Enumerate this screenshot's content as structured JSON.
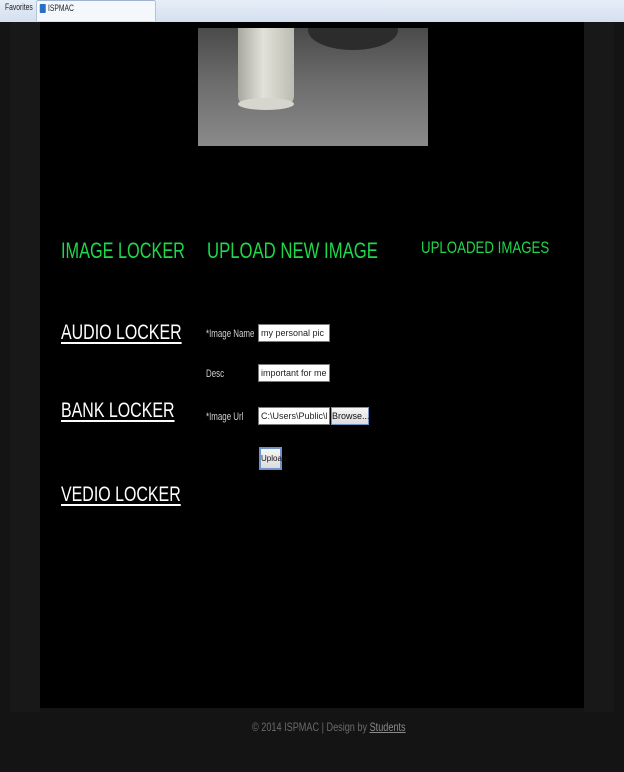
{
  "browser": {
    "tabs": [
      {
        "label": "Favorites"
      },
      {
        "label": "ISPMAC"
      }
    ]
  },
  "sidebar": {
    "title": "IMAGE LOCKER",
    "links": [
      {
        "label": "AUDIO LOCKER"
      },
      {
        "label": "BANK LOCKER"
      },
      {
        "label": "VEDIO LOCKER"
      }
    ]
  },
  "upload": {
    "title": "UPLOAD NEW IMAGE",
    "image_name_label": "Image Name",
    "image_name_value": "my personal pic",
    "desc_label": "Desc",
    "desc_value": "important for me",
    "image_url_label": "Image Url",
    "image_url_value": "C:\\Users\\Public\\Pictures\\",
    "browse_label": "Browse...",
    "upload_label": "Upload",
    "required_marker": "*"
  },
  "uploaded": {
    "title": "UPLOADED IMAGES"
  },
  "footer": {
    "text": "© 2014 ISPMAC | Design by",
    "link": "Students"
  }
}
